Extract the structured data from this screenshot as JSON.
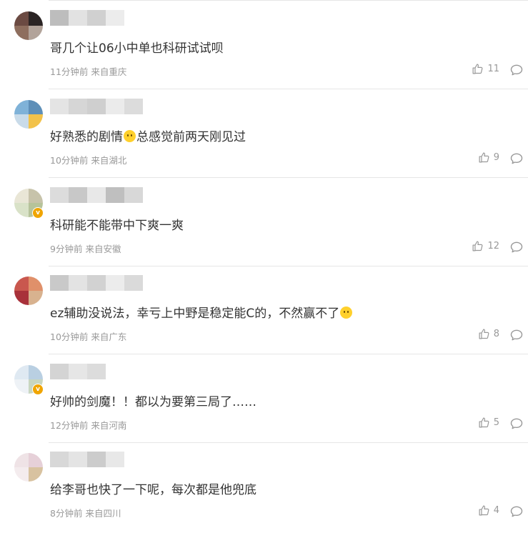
{
  "comments": [
    {
      "text": "哥几个让06小中单也科研试试呗",
      "emoji": false,
      "text_after": "",
      "time": "11分钟前",
      "location": "来自重庆",
      "likes": "11",
      "verified": false,
      "avatar": [
        "#6b4a42",
        "#2b2424",
        "#8e6e5e",
        "#b2a39a"
      ],
      "name_shades": [
        "#bdbdbd",
        "#e2e2e2",
        "#d0d0d0",
        "#ececec"
      ]
    },
    {
      "text": "好熟悉的剧情",
      "emoji": true,
      "text_after": "总感觉前两天刚见过",
      "time": "10分钟前",
      "location": "来自湖北",
      "likes": "9",
      "verified": false,
      "avatar": [
        "#7fb2d8",
        "#5e8fb8",
        "#c9dbe9",
        "#f2c24a"
      ],
      "name_shades": [
        "#e4e4e4",
        "#d6d6d6",
        "#cfcfcf",
        "#ebebeb",
        "#dcdcdc"
      ]
    },
    {
      "text": "科研能不能带中下爽一爽",
      "emoji": false,
      "text_after": "",
      "time": "9分钟前",
      "location": "来自安徽",
      "likes": "12",
      "verified": true,
      "avatar": [
        "#e9e6d6",
        "#c7c3aa",
        "#d9e2c8",
        "#b6c39a"
      ],
      "name_shades": [
        "#dcdcdc",
        "#c8c8c8",
        "#e8e8e8",
        "#bfbfbf",
        "#d8d8d8"
      ]
    },
    {
      "text": "ez辅助没说法，幸亏上中野是稳定能C的，不然赢不了",
      "emoji": true,
      "text_after": "",
      "time": "10分钟前",
      "location": "来自广东",
      "likes": "8",
      "verified": false,
      "avatar": [
        "#c9574e",
        "#e0906a",
        "#a8313a",
        "#d8b28f"
      ],
      "name_shades": [
        "#c9c9c9",
        "#e3e3e3",
        "#d2d2d2",
        "#ececec",
        "#dadada"
      ]
    },
    {
      "text": "好帅的剑魔！！都以为要第三局了……",
      "emoji": false,
      "text_after": "",
      "time": "12分钟前",
      "location": "来自河南",
      "likes": "5",
      "verified": true,
      "avatar": [
        "#dfe9f2",
        "#b9cfe2",
        "#eef2f6",
        "#c8d6c0"
      ],
      "name_shades": [
        "#d4d4d4",
        "#e6e6e6",
        "#dcdcdc"
      ]
    },
    {
      "text": "给李哥也快了一下呢，每次都是他兜底",
      "emoji": false,
      "text_after": "",
      "time": "8分钟前",
      "location": "来自四川",
      "likes": "4",
      "verified": false,
      "avatar": [
        "#efe3e6",
        "#e6d0d8",
        "#f4ecee",
        "#d8c2a0"
      ],
      "name_shades": [
        "#d8d8d8",
        "#e4e4e4",
        "#cccccc",
        "#e8e8e8"
      ]
    }
  ]
}
